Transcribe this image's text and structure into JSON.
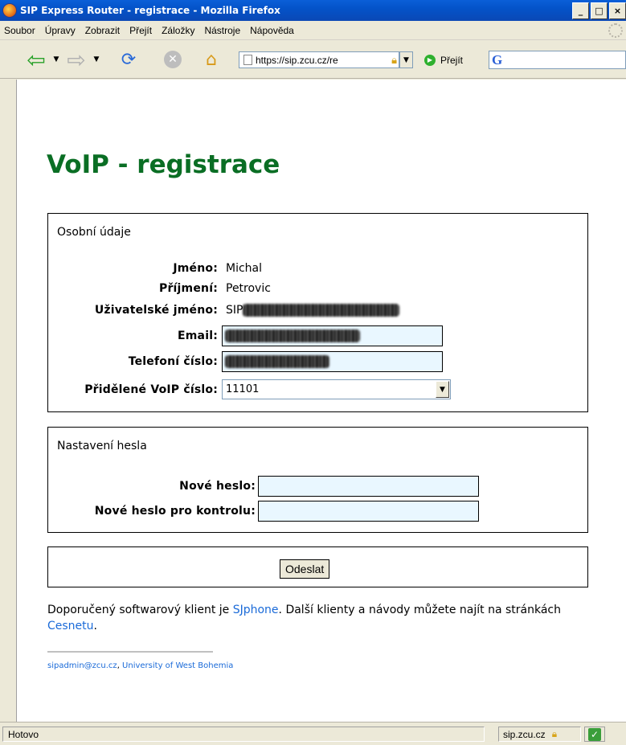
{
  "window": {
    "title": "SIP Express Router - registrace - Mozilla Firefox",
    "controls": [
      "_",
      "□",
      "×"
    ]
  },
  "menu": {
    "items": [
      "Soubor",
      "Úpravy",
      "Zobrazit",
      "Přejít",
      "Záložky",
      "Nástroje",
      "Nápověda"
    ]
  },
  "toolbar": {
    "url": "https://sip.zcu.cz/re",
    "go_label": "Přejít",
    "icons": [
      "back-icon",
      "forward-icon",
      "reload-icon",
      "stop-icon",
      "home-icon",
      "lock-icon",
      "google-icon"
    ]
  },
  "page": {
    "heading": "VoIP - registrace",
    "personal": {
      "legend": "Osobní údaje",
      "first_name_label": "Jméno:",
      "first_name": "Michal",
      "last_name_label": "Příjmení:",
      "last_name": "Petrovic",
      "username_label": "Uživatelské jméno:",
      "username_prefix": "SIP",
      "email_label": "Email:",
      "phone_label": "Telefoní číslo:",
      "voip_label": "Přidělené VoIP číslo:",
      "voip_selected": "11101"
    },
    "password": {
      "legend": "Nastavení hesla",
      "new_label": "Nové heslo:",
      "confirm_label": "Nové heslo pro kontrolu:"
    },
    "submit_label": "Odeslat",
    "paragraph": {
      "text1": "Doporučený softwarový klient je ",
      "link1": "SJphone",
      "text2": ". Další klienty a návody můžete najít na stránkách ",
      "link2": "Cesnetu",
      "text3": "."
    },
    "footer": {
      "email": "sipadmin@zcu.cz",
      "sep": ", ",
      "org": "University of West Bohemia"
    }
  },
  "status": {
    "text": "Hotovo",
    "site": "sip.zcu.cz"
  }
}
